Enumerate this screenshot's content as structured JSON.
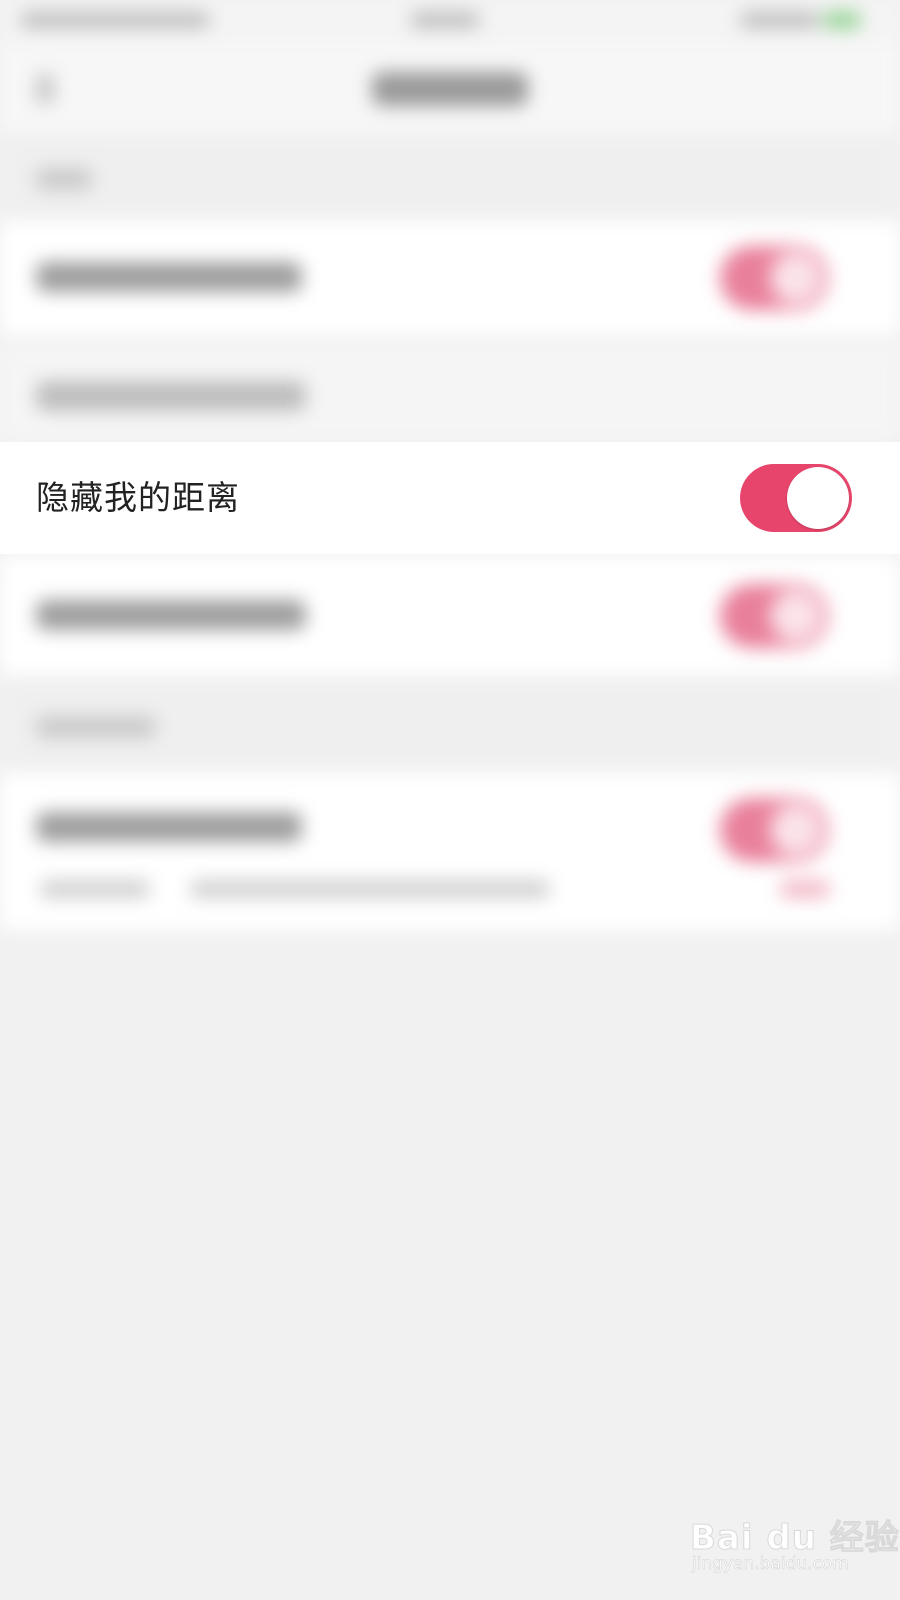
{
  "focused_setting": {
    "label": "隐藏我的距离",
    "toggle_on": true
  },
  "colors": {
    "accent": "#e8456c",
    "page_background": "#f1f1f1",
    "row_background": "#ffffff",
    "label_text": "#222222"
  },
  "watermark": {
    "logo_text": "Bai du 经验",
    "url_text": "jingyan.baidu.com"
  }
}
